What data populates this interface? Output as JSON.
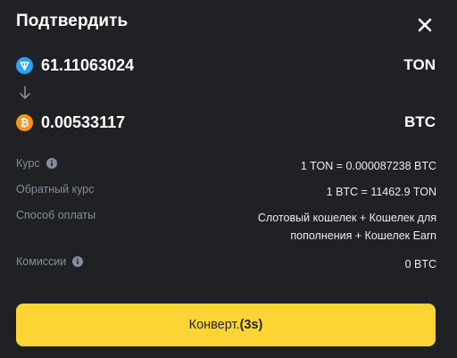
{
  "dialog": {
    "title": "Подтвердить"
  },
  "from": {
    "amount": "61.11063024",
    "symbol": "TON",
    "icon": "ton-coin-icon",
    "color": "#2aa3f3"
  },
  "to": {
    "amount": "0.00533117",
    "symbol": "BTC",
    "icon": "btc-coin-icon",
    "color": "#f7931a"
  },
  "details": {
    "rate_label": "Курс",
    "rate_value": "1 TON = 0.000087238 BTC",
    "inverse_label": "Обратный курс",
    "inverse_value": "1 BTC = 11462.9 TON",
    "method_label": "Способ оплаты",
    "method_value": "Слотовый кошелек + Кошелек для пополнения + Кошелек Earn",
    "fee_label": "Комиссии",
    "fee_value": "0 BTC"
  },
  "button": {
    "label": "Конверт.",
    "countdown": "(3s)",
    "color": "#fcd535"
  },
  "colors": {
    "background": "#1f2125",
    "muted_text": "#848e9c",
    "primary_text": "#eaecef"
  }
}
